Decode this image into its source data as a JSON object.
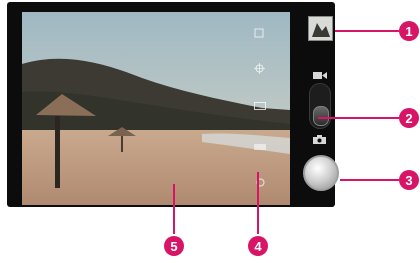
{
  "callouts": [
    {
      "id": "c1",
      "label": "1"
    },
    {
      "id": "c2",
      "label": "2"
    },
    {
      "id": "c3",
      "label": "3"
    },
    {
      "id": "c4",
      "label": "4"
    },
    {
      "id": "c5",
      "label": "5"
    }
  ],
  "icons": {
    "settings": "gear-icon",
    "flash": "flash-icon",
    "scene": "scene-icon",
    "zoom": "zoom-icon",
    "exposure": "exposure-icon",
    "video_mode": "video-camera-icon",
    "photo_mode": "camera-icon"
  },
  "colors": {
    "callout": "#d81466",
    "body": "#0c0c0c"
  }
}
